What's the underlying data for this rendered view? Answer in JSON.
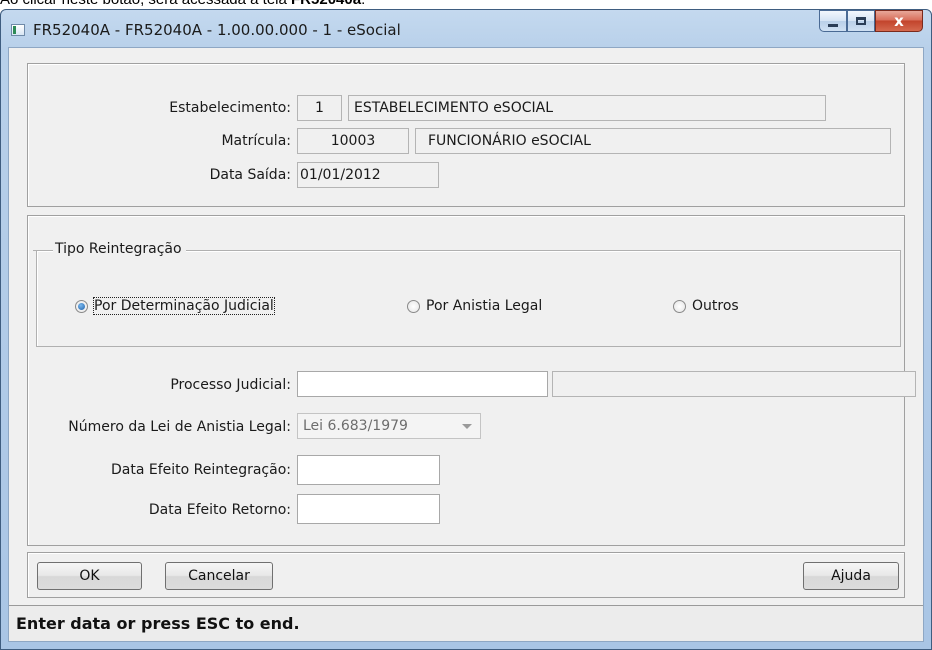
{
  "caption": {
    "text_before": "Ao clicar neste botão, será acessada a tela ",
    "bold": "FR52040a",
    "after": "."
  },
  "window": {
    "title": "FR52040A - FR52040A - 1.00.00.000 - 1 - eSocial",
    "minimize": "minimize",
    "maximize": "maximize",
    "close": "x"
  },
  "header": {
    "estabelecimento_label": "Estabelecimento:",
    "estabelecimento_code": "1",
    "estabelecimento_name": "ESTABELECIMENTO eSOCIAL",
    "matricula_label": "Matrícula:",
    "matricula_code": "10003",
    "matricula_name": "FUNCIONÁRIO eSOCIAL",
    "data_saida_label": "Data Saída:",
    "data_saida": "01/01/2012"
  },
  "tipo": {
    "legend": "Tipo Reintegração",
    "options": [
      {
        "label": "Por Determinação Judicial",
        "selected": true
      },
      {
        "label": "Por Anistia Legal",
        "selected": false
      },
      {
        "label": "Outros",
        "selected": false
      }
    ]
  },
  "details": {
    "processo_label": "Processo Judicial:",
    "processo_value": "",
    "processo_desc": "",
    "lei_label": "Número da Lei de Anistia Legal:",
    "lei_value": "Lei 6.683/1979",
    "efeito_reint_label": "Data Efeito Reintegração:",
    "efeito_reint_value": "",
    "efeito_retorno_label": "Data Efeito Retorno:",
    "efeito_retorno_value": ""
  },
  "buttons": {
    "ok": "OK",
    "cancelar": "Cancelar",
    "ajuda": "Ajuda"
  },
  "status": {
    "text": "Enter data or press ESC to end."
  }
}
